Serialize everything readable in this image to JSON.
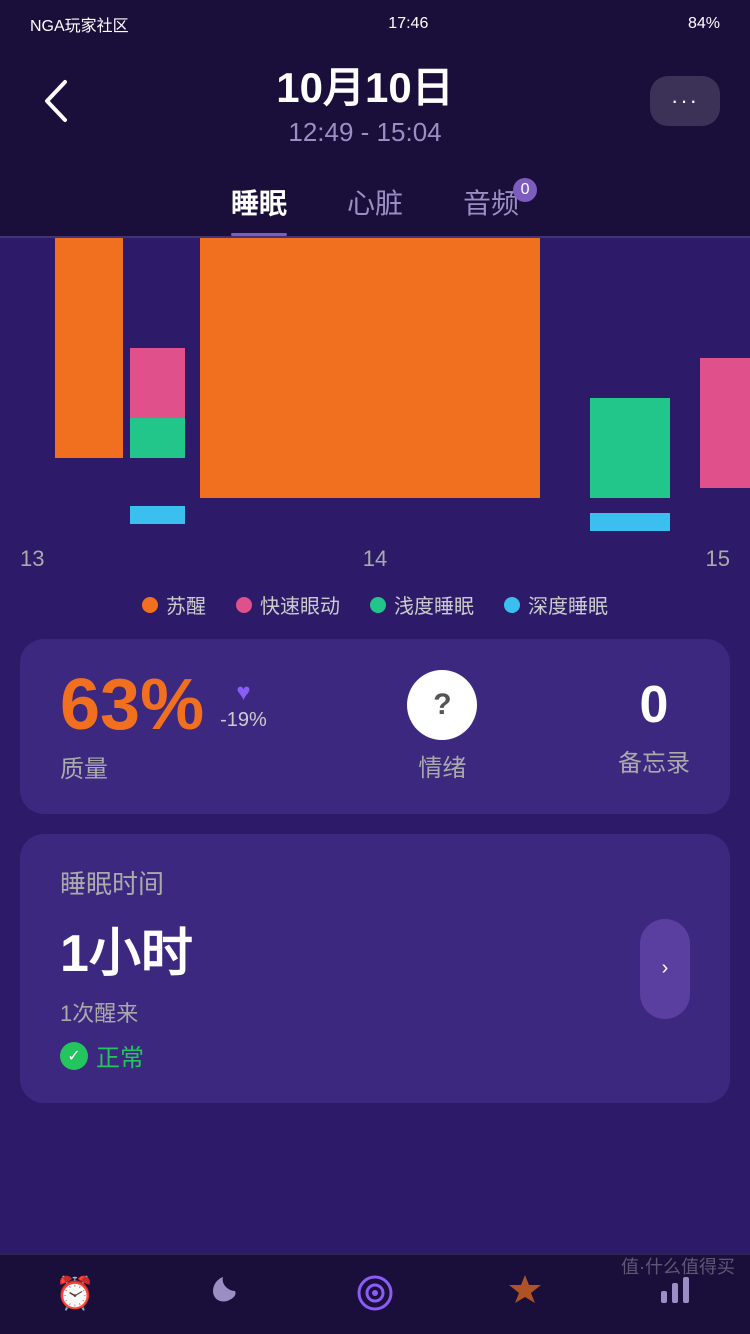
{
  "statusBar": {
    "carrier": "NGA玩家社区",
    "time": "17:46",
    "battery": "84%"
  },
  "header": {
    "date": "10月10日",
    "timeRange": "12:49 - 15:04",
    "backLabel": "<",
    "moreLabel": "···"
  },
  "tabs": [
    {
      "label": "睡眠",
      "active": true,
      "badge": null
    },
    {
      "label": "心脏",
      "active": false,
      "badge": null
    },
    {
      "label": "音频",
      "active": false,
      "badge": "0"
    }
  ],
  "chart": {
    "xLabels": [
      "13",
      "14",
      "15"
    ],
    "legend": [
      {
        "label": "苏醒",
        "color": "#f07020"
      },
      {
        "label": "快速眼动",
        "color": "#e0508a"
      },
      {
        "label": "浅度睡眠",
        "color": "#22c58a"
      },
      {
        "label": "深度睡眠",
        "color": "#3bbfef"
      }
    ]
  },
  "statsCard": {
    "quality": {
      "percent": "63%",
      "change": "-19%",
      "label": "质量"
    },
    "mood": {
      "label": "情绪",
      "iconLabel": "?"
    },
    "notes": {
      "value": "0",
      "label": "备忘录"
    }
  },
  "sleepCard": {
    "title": "睡眠时间",
    "duration": "1小时",
    "wakeups": "1次醒来",
    "status": "正常"
  },
  "bottomNav": [
    {
      "icon": "⏰",
      "label": "",
      "active": false
    },
    {
      "icon": "🌙",
      "label": "",
      "active": false
    },
    {
      "icon": "◎",
      "label": "",
      "active": true
    },
    {
      "icon": "🎄",
      "label": "",
      "active": false
    },
    {
      "icon": "📊",
      "label": "",
      "active": false
    }
  ],
  "watermark": "值·什么值得买"
}
